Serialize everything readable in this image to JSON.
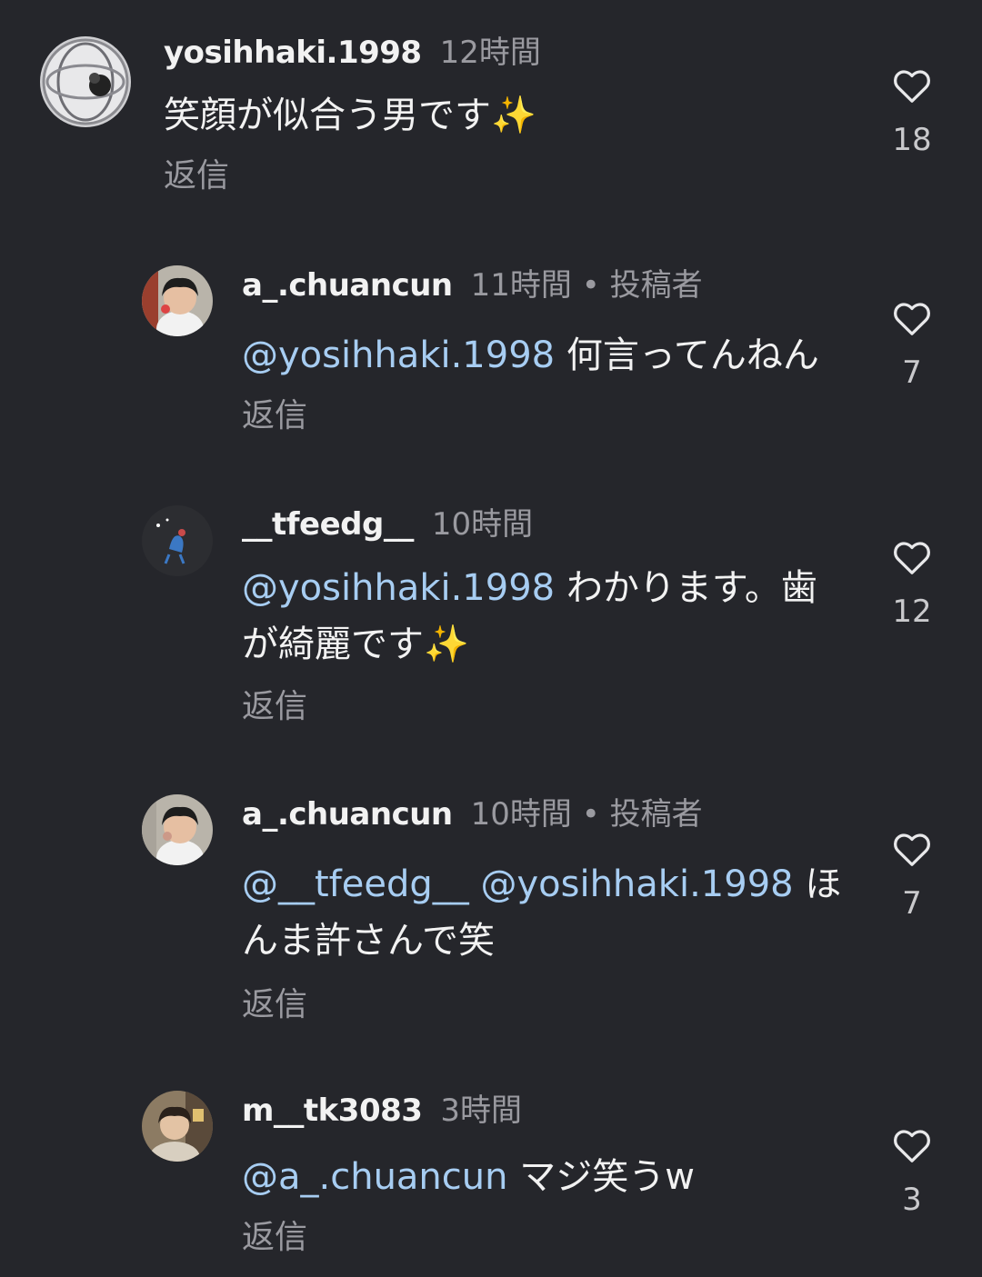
{
  "comments": [
    {
      "username": "yosihhaki.1998",
      "meta": "12時間",
      "mentions": [],
      "text": "笑顔が似合う男です✨",
      "reply": "返信",
      "likes": "18",
      "avatar": "globe-avatar"
    },
    {
      "username": "a_.chuancun",
      "meta": "11時間 • 投稿者",
      "mentions": [
        "@yosihhaki.1998"
      ],
      "text": "何言ってんねん",
      "reply": "返信",
      "likes": "7",
      "avatar": "child-avatar"
    },
    {
      "username": "__tfeedg__",
      "meta": "10時間",
      "mentions": [
        "@yosihhaki.1998"
      ],
      "text": "わかります。歯が綺麗です✨",
      "reply": "返信",
      "likes": "12",
      "avatar": "dark-avatar"
    },
    {
      "username": "a_.chuancun",
      "meta": "10時間 • 投稿者",
      "mentions": [
        "@__tfeedg__",
        "@yosihhaki.1998"
      ],
      "text": "ほんま許さんで笑",
      "reply": "返信",
      "likes": "7",
      "avatar": "child-avatar"
    },
    {
      "username": "m__tk3083",
      "meta": "3時間",
      "mentions": [
        "@a_.chuancun"
      ],
      "text": "マジ笑うw",
      "reply": "返信",
      "likes": "3",
      "avatar": "person-avatar"
    }
  ],
  "icons": {
    "like": "heart-outline-icon"
  },
  "colors": {
    "background": "#25262b",
    "mention": "#a7cdf2",
    "meta": "#9a9aa0"
  }
}
